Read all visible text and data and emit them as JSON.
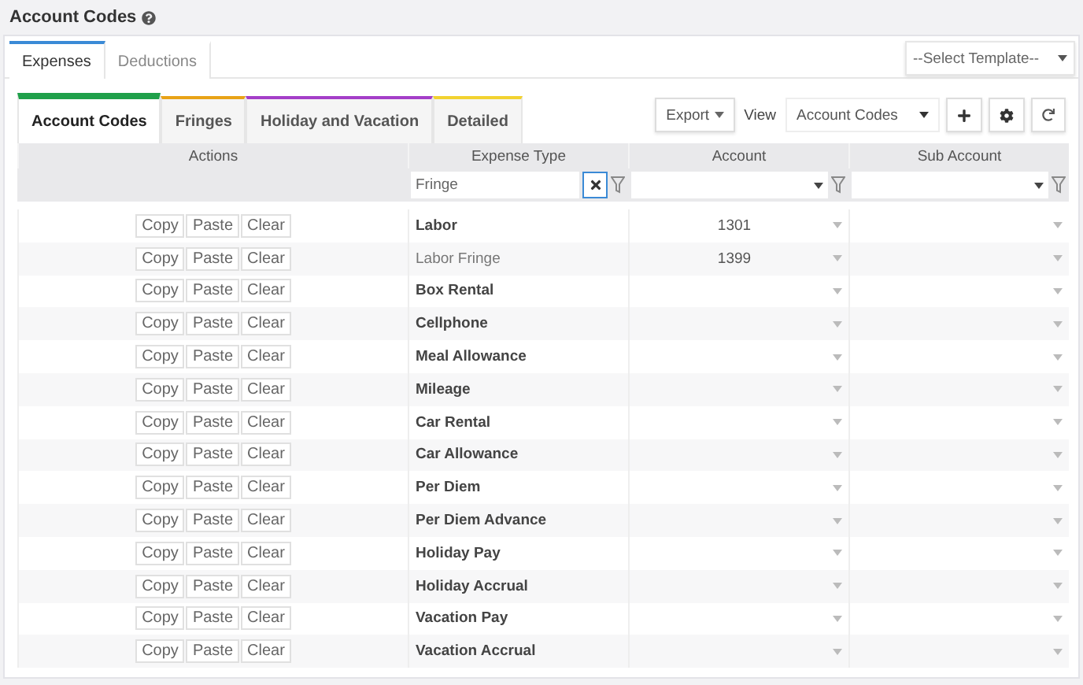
{
  "page_title": "Account Codes",
  "tabs": [
    {
      "label": "Expenses",
      "selected": true
    },
    {
      "label": "Deductions",
      "selected": false
    }
  ],
  "template_select": {
    "value": "--Select Template--"
  },
  "sub_tabs": [
    {
      "label": "Account Codes",
      "selected": true,
      "color": "#1fa04a"
    },
    {
      "label": "Fringes",
      "selected": false,
      "color": "#e8a317"
    },
    {
      "label": "Holiday and Vacation",
      "selected": false,
      "color": "#a43fc8"
    },
    {
      "label": "Detailed",
      "selected": false,
      "color": "#f2d230"
    }
  ],
  "toolbar": {
    "export": "Export",
    "view_label": "View",
    "view_value": "Account Codes"
  },
  "table": {
    "columns": [
      "Actions",
      "Expense Type",
      "Account",
      "Sub Account"
    ],
    "filters": {
      "expense_type": "Fringe"
    },
    "rows": [
      {
        "actions": [
          "Copy",
          "Paste",
          "Clear"
        ],
        "expense_type": "Labor",
        "kind": "expense",
        "account": "1301"
      },
      {
        "actions": [
          "Copy",
          "Paste",
          "Clear"
        ],
        "expense_type": "Labor Fringe",
        "kind": "fringe",
        "account": "1399"
      },
      {
        "actions": [
          "Copy",
          "Paste",
          "Clear"
        ],
        "expense_type": "Box Rental",
        "kind": "expense"
      },
      {
        "actions": [
          "Copy",
          "Paste",
          "Clear"
        ],
        "expense_type": "Cellphone",
        "kind": "expense"
      },
      {
        "actions": [
          "Copy",
          "Paste",
          "Clear"
        ],
        "expense_type": "Meal Allowance",
        "kind": "expense"
      },
      {
        "actions": [
          "Copy",
          "Paste",
          "Clear"
        ],
        "expense_type": "Mileage",
        "kind": "expense"
      },
      {
        "actions": [
          "Copy",
          "Paste",
          "Clear"
        ],
        "expense_type": "Car Rental",
        "kind": "expense"
      },
      {
        "actions": [
          "Copy",
          "Paste",
          "Clear"
        ],
        "expense_type": "Car Allowance",
        "kind": "expense"
      },
      {
        "actions": [
          "Copy",
          "Paste",
          "Clear"
        ],
        "expense_type": "Per Diem",
        "kind": "expense"
      },
      {
        "actions": [
          "Copy",
          "Paste",
          "Clear"
        ],
        "expense_type": "Per Diem Advance",
        "kind": "expense"
      },
      {
        "actions": [
          "Copy",
          "Paste",
          "Clear"
        ],
        "expense_type": "Holiday Pay",
        "kind": "expense"
      },
      {
        "actions": [
          "Copy",
          "Paste",
          "Clear"
        ],
        "expense_type": "Holiday Accrual",
        "kind": "expense"
      },
      {
        "actions": [
          "Copy",
          "Paste",
          "Clear"
        ],
        "expense_type": "Vacation Pay",
        "kind": "expense"
      },
      {
        "actions": [
          "Copy",
          "Paste",
          "Clear"
        ],
        "expense_type": "Vacation Accrual",
        "kind": "expense"
      }
    ]
  }
}
